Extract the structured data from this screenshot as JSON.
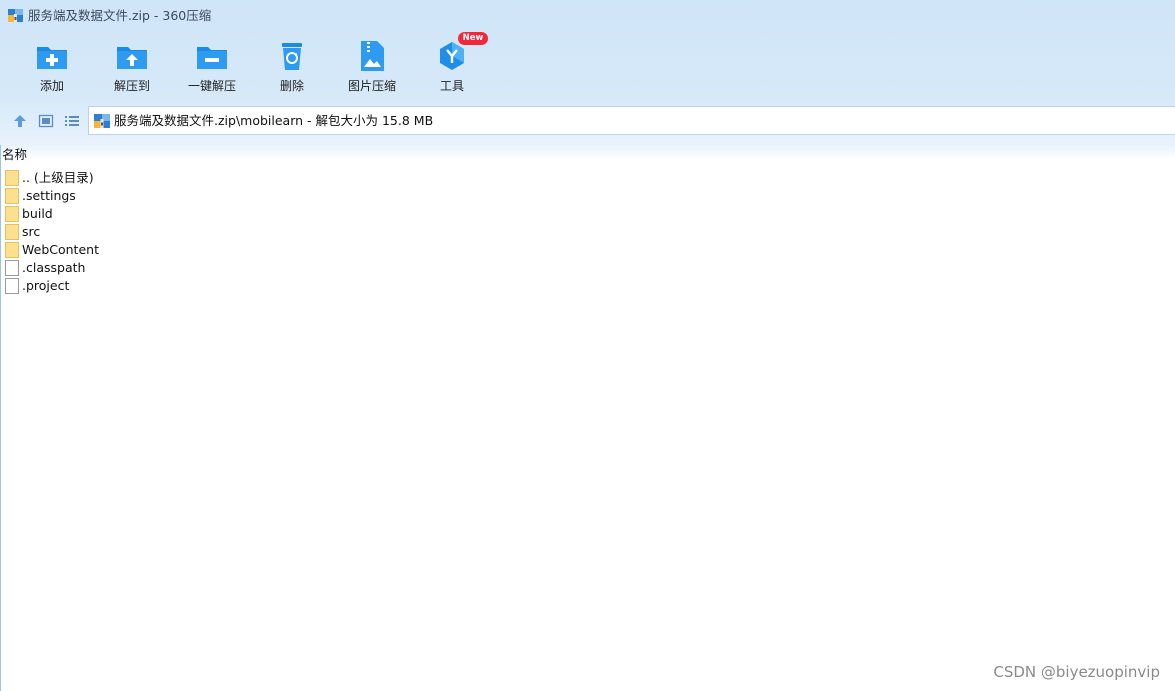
{
  "window": {
    "title": "服务端及数据文件.zip - 360压缩"
  },
  "toolbar": {
    "items": [
      {
        "label": "添加",
        "icon": "add-folder-icon"
      },
      {
        "label": "解压到",
        "icon": "extract-to-icon"
      },
      {
        "label": "一键解压",
        "icon": "one-click-extract-icon"
      },
      {
        "label": "删除",
        "icon": "recycle-bin-icon"
      },
      {
        "label": "图片压缩",
        "icon": "image-compress-icon"
      },
      {
        "label": "工具",
        "icon": "tools-icon",
        "badge": "New"
      }
    ]
  },
  "nav": {
    "up_icon": "up-arrow-icon",
    "thumbnail_icon": "thumbnail-view-icon",
    "list_icon": "list-view-icon",
    "path": "服务端及数据文件.zip\\mobilearn - 解包大小为 15.8 MB"
  },
  "list": {
    "column_name": "名称",
    "items": [
      {
        "name": ".. (上级目录)",
        "type": "folder"
      },
      {
        "name": ".settings",
        "type": "folder"
      },
      {
        "name": "build",
        "type": "folder"
      },
      {
        "name": "src",
        "type": "folder"
      },
      {
        "name": "WebContent",
        "type": "folder"
      },
      {
        "name": ".classpath",
        "type": "file"
      },
      {
        "name": ".project",
        "type": "file"
      }
    ]
  },
  "watermark": "CSDN @biyezuopinvip",
  "colors": {
    "accent": "#1e8ee8",
    "toolbar_bg": "#d3e7f9",
    "badge": "#f2283a",
    "folder": "#fbe08f"
  }
}
